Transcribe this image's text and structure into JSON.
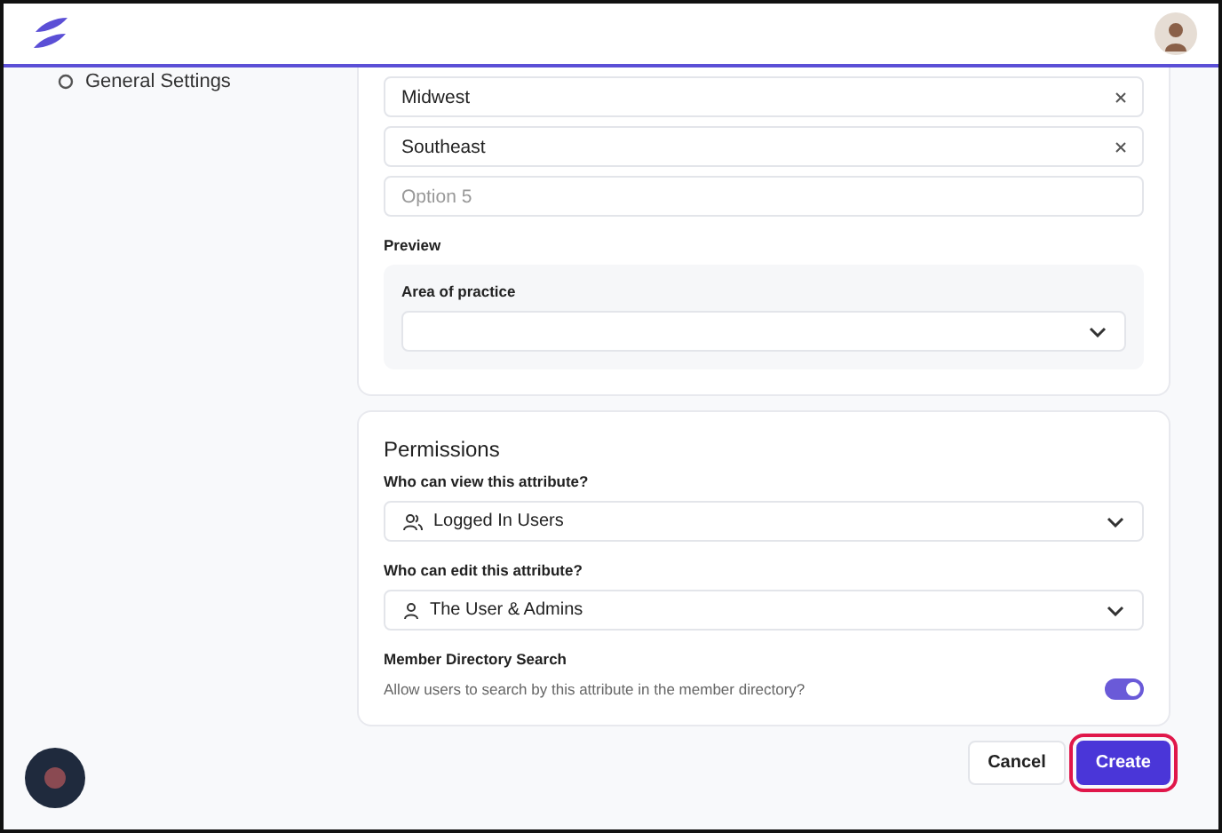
{
  "sidebar": {
    "items": [
      {
        "label": "General Settings"
      }
    ]
  },
  "options": [
    {
      "value": "Midwest",
      "removable": true
    },
    {
      "value": "Southeast",
      "removable": true
    },
    {
      "placeholder": "Option 5",
      "removable": false
    }
  ],
  "preview": {
    "label": "Preview",
    "field_label": "Area of practice"
  },
  "permissions": {
    "title": "Permissions",
    "view_label": "Who can view this attribute?",
    "view_value": "Logged In Users",
    "edit_label": "Who can edit this attribute?",
    "edit_value": "The User & Admins",
    "search_title": "Member Directory Search",
    "search_text": "Allow users to search by this attribute in the member directory?",
    "search_on": true
  },
  "buttons": [
    {
      "label": "Cancel",
      "kind": "secondary",
      "highlighted": false
    },
    {
      "label": "Create",
      "kind": "primary",
      "highlighted": true
    }
  ]
}
